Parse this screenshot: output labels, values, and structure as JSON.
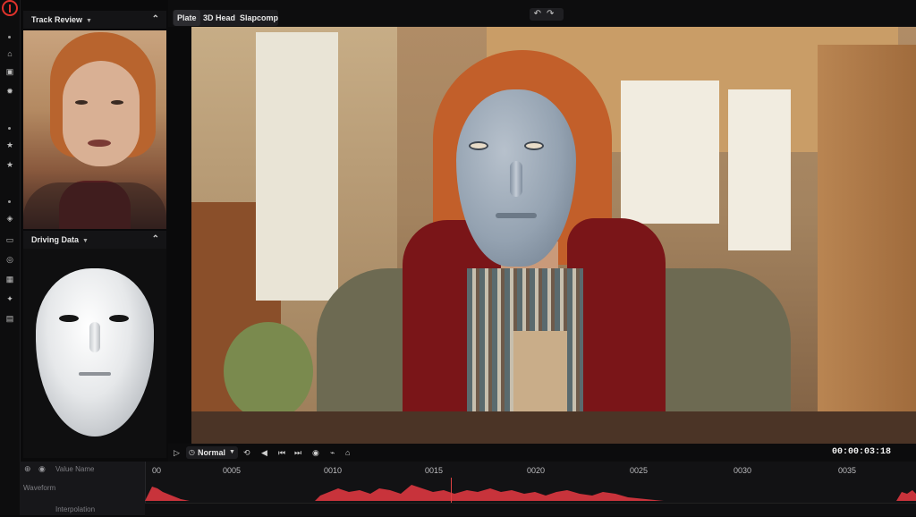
{
  "panels": {
    "track_review": {
      "title": "Track Review"
    },
    "driving_data": {
      "title": "Driving Data"
    }
  },
  "viewer": {
    "tabs": [
      "Plate",
      "3D Head",
      "Slapcomp"
    ],
    "undo_icon": "undo-icon",
    "redo_icon": "redo-icon"
  },
  "playback": {
    "mode": "Normal",
    "timecode": "00:00:03:18"
  },
  "timeline": {
    "ticks": [
      "00",
      "0005",
      "0010",
      "0015",
      "0020",
      "0025",
      "0030",
      "0035"
    ],
    "rows": [
      "Value Name",
      "Waveform",
      "Interpolation"
    ]
  },
  "colors": {
    "accent": "#e0322b",
    "waveform": "#c8333b"
  }
}
